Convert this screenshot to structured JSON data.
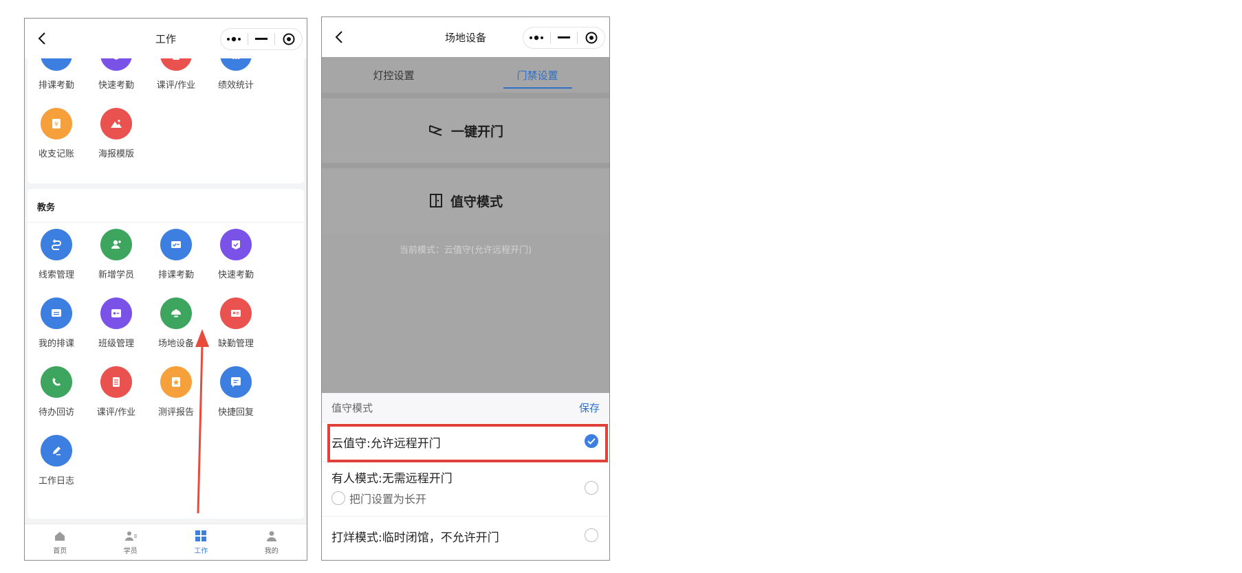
{
  "left_phone": {
    "nav": {
      "title": "工作"
    },
    "top_row": [
      {
        "label": "排课考勤",
        "icon": "schedule-check-icon",
        "color": "#3d7fe0"
      },
      {
        "label": "快速考勤",
        "icon": "quick-check-icon",
        "color": "#7a52e8"
      },
      {
        "label": "课评/作业",
        "icon": "review-list-icon",
        "color": "#e9524e"
      },
      {
        "label": "绩效统计",
        "icon": "bar-chart-icon",
        "color": "#3d7fe0"
      }
    ],
    "finance_row": [
      {
        "label": "收支记账",
        "icon": "yuan-ledger-icon",
        "color": "#f5a03a"
      },
      {
        "label": "海报模版",
        "icon": "poster-image-icon",
        "color": "#e9524e"
      }
    ],
    "academic": {
      "title": "教务",
      "items": [
        {
          "label": "线索管理",
          "icon": "leads-icon",
          "color": "#3d7fe0"
        },
        {
          "label": "新增学员",
          "icon": "add-student-icon",
          "color": "#3ea55f"
        },
        {
          "label": "排课考勤",
          "icon": "schedule-check-icon",
          "color": "#3d7fe0"
        },
        {
          "label": "快速考勤",
          "icon": "quick-check-icon",
          "color": "#7a52e8"
        },
        {
          "label": "我的排课",
          "icon": "my-schedule-icon",
          "color": "#3d7fe0"
        },
        {
          "label": "班级管理",
          "icon": "class-card-icon",
          "color": "#7a52e8"
        },
        {
          "label": "场地设备",
          "icon": "venue-device-icon",
          "color": "#3ea55f"
        },
        {
          "label": "缺勤管理",
          "icon": "absence-icon",
          "color": "#e9524e"
        },
        {
          "label": "待办回访",
          "icon": "phone-callback-icon",
          "color": "#3ea55f"
        },
        {
          "label": "课评/作业",
          "icon": "review-list-icon",
          "color": "#e9524e"
        },
        {
          "label": "测评报告",
          "icon": "report-star-icon",
          "color": "#f5a03a"
        },
        {
          "label": "快捷回复",
          "icon": "quick-reply-icon",
          "color": "#3d7fe0"
        },
        {
          "label": "工作日志",
          "icon": "work-log-icon",
          "color": "#3d7fe0"
        }
      ]
    },
    "tabbar": [
      {
        "label": "首页",
        "icon": "home-icon",
        "active": false
      },
      {
        "label": "学员",
        "icon": "students-icon",
        "active": false
      },
      {
        "label": "工作",
        "icon": "work-grid-icon",
        "active": true
      },
      {
        "label": "我的",
        "icon": "profile-icon",
        "active": false
      }
    ]
  },
  "right_phone": {
    "nav": {
      "title": "场地设备"
    },
    "tabs": [
      {
        "label": "灯控设置",
        "active": false
      },
      {
        "label": "门禁设置",
        "active": true
      }
    ],
    "one_key_open": "一键开门",
    "guard_mode": "值守模式",
    "current_mode": "当前模式：云值守(允许远程开门)",
    "sheet": {
      "title": "值守模式",
      "save": "保存",
      "options": [
        {
          "label": "云值守:允许远程开门",
          "selected": true
        },
        {
          "label": "有人模式:无需远程开门",
          "selected": false,
          "sub_option": "把门设置为长开"
        },
        {
          "label": "打烊模式:临时闭馆，不允许开门",
          "selected": false
        }
      ]
    }
  },
  "colors": {
    "accent": "#3d7fe0",
    "highlight": "#e0413a",
    "overlay": "#a6a6a6"
  }
}
